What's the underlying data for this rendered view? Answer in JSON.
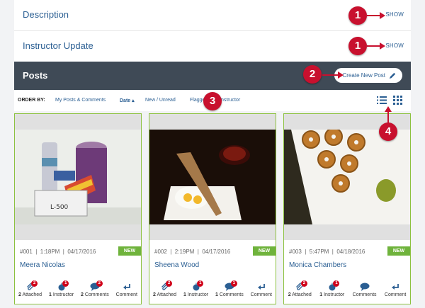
{
  "sections": [
    {
      "title": "Description",
      "action": "SHOW"
    },
    {
      "title": "Instructor Update",
      "action": "SHOW"
    }
  ],
  "posts": {
    "title": "Posts",
    "create_label": "Create New Post"
  },
  "order": {
    "label": "ORDER BY:",
    "options": [
      "My Posts & Comments",
      "Date ▴",
      "New / Unread",
      "Flagged",
      "Instructor"
    ]
  },
  "callouts": [
    "1",
    "1",
    "2",
    "3",
    "4"
  ],
  "cards": [
    {
      "id": "#001",
      "time": "1:18PM",
      "date": "04/17/2016",
      "badge": "NEW",
      "name": "Meera Nicolas",
      "stats": [
        {
          "n": "2",
          "t": "Attached",
          "b": "2"
        },
        {
          "n": "1",
          "t": "Instructor",
          "b": "1"
        },
        {
          "n": "2",
          "t": "Comments",
          "b": "2"
        },
        {
          "n": "",
          "t": "Comment",
          "b": ""
        }
      ]
    },
    {
      "id": "#002",
      "time": "2:19PM",
      "date": "04/17/2016",
      "badge": "NEW",
      "name": "Sheena Wood",
      "stats": [
        {
          "n": "2",
          "t": "Attached",
          "b": "2"
        },
        {
          "n": "1",
          "t": "Instructor",
          "b": "1"
        },
        {
          "n": "1",
          "t": "Comments",
          "b": "1"
        },
        {
          "n": "",
          "t": "Comment",
          "b": ""
        }
      ]
    },
    {
      "id": "#003",
      "time": "5:47PM",
      "date": "04/18/2016",
      "badge": "NEW",
      "name": "Monica Chambers",
      "stats": [
        {
          "n": "2",
          "t": "Attached",
          "b": "2"
        },
        {
          "n": "1",
          "t": "Instructor",
          "b": "1"
        },
        {
          "n": "",
          "t": "Comments",
          "b": ""
        },
        {
          "n": "",
          "t": "Comment",
          "b": ""
        }
      ]
    }
  ],
  "colors": {
    "accent": "#2b5f93",
    "posts_bar": "#3f4a56",
    "new_badge": "#6fb33c",
    "callout": "#c8102e"
  }
}
